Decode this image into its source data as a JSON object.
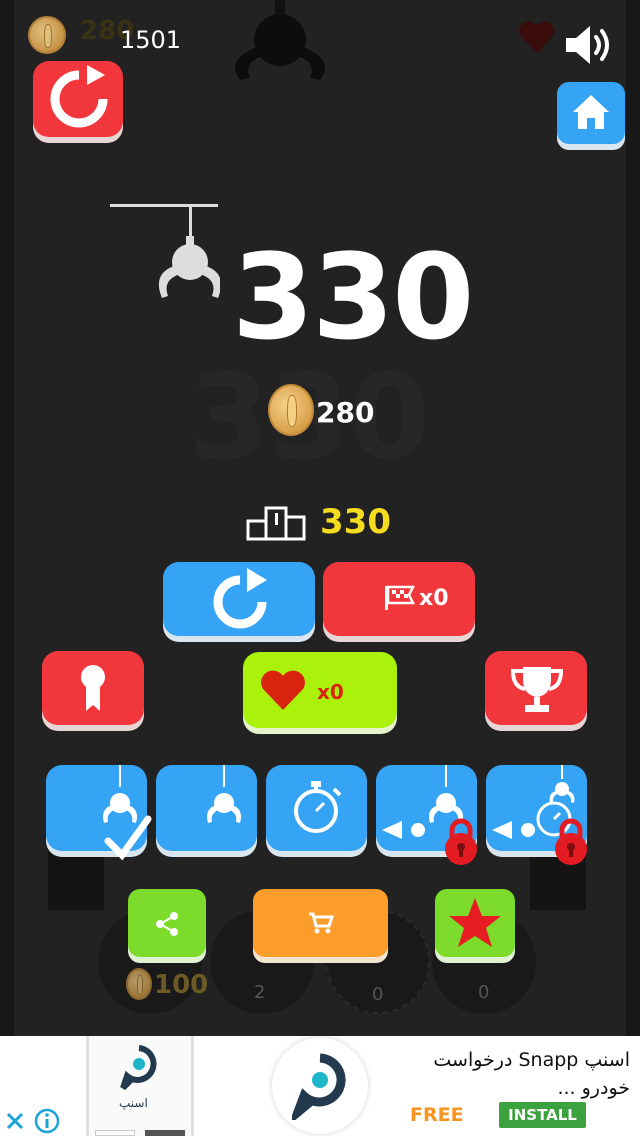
{
  "hud": {
    "coins_total": "1501",
    "ghost_coins": "280",
    "restart_shop_icon": "cart-refresh-icon",
    "home_icon": "home-icon",
    "sound_icon": "speaker-icon",
    "lives_icon": "heart-icon"
  },
  "result": {
    "score": "330",
    "coins_earned": "280",
    "best_score": "330"
  },
  "buttons": {
    "retry_icon": "retry-icon",
    "continue_count": "x0",
    "heart_count": "x0",
    "bottom_coin_cost": "100"
  },
  "shelf_counts": [
    "2",
    "0",
    "0"
  ],
  "colors": {
    "blue": "#35a4f4",
    "red": "#f1373b",
    "lime": "#aaf10b",
    "orange": "#fb9c2b",
    "green": "#7ddb2c",
    "gold": "#f5dc1e"
  },
  "ad": {
    "headline": "اسنپ Snapp درخواست خودرو ...",
    "free_label": "FREE",
    "install_label": "INSTALL",
    "thumb_caption": "اسنپ"
  }
}
